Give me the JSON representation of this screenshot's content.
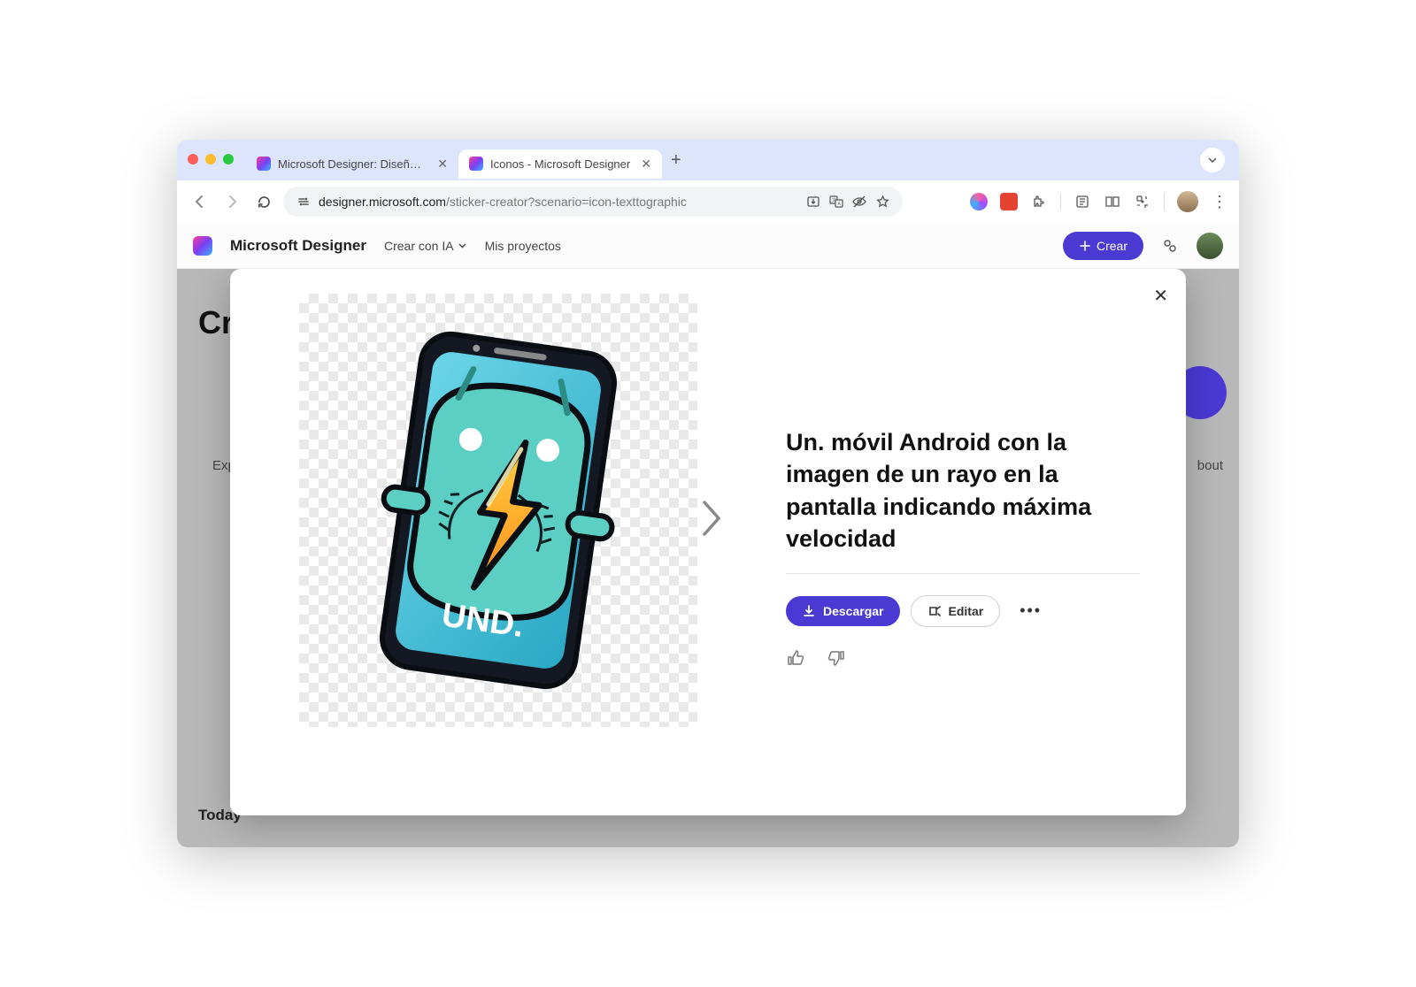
{
  "browser": {
    "tabs": [
      {
        "title": "Microsoft Designer: Diseños s"
      },
      {
        "title": "Iconos - Microsoft Designer"
      }
    ],
    "url_domain": "designer.microsoft.com",
    "url_path": "/sticker-creator?scenario=icon-texttographic"
  },
  "app": {
    "title": "Microsoft Designer",
    "nav": {
      "crear_ia": "Crear con IA",
      "mis_proyectos": "Mis proyectos"
    },
    "header_button": "Crear"
  },
  "background": {
    "heading_partial": "Cr",
    "left_label": "Exp",
    "right_label": "bout",
    "bottom_label": "Today"
  },
  "modal": {
    "prompt": "Un. móvil Android con la imagen de un rayo en la pantalla indicando máxima velocidad",
    "image_text": "UND.",
    "download_label": "Descargar",
    "edit_label": "Editar"
  }
}
